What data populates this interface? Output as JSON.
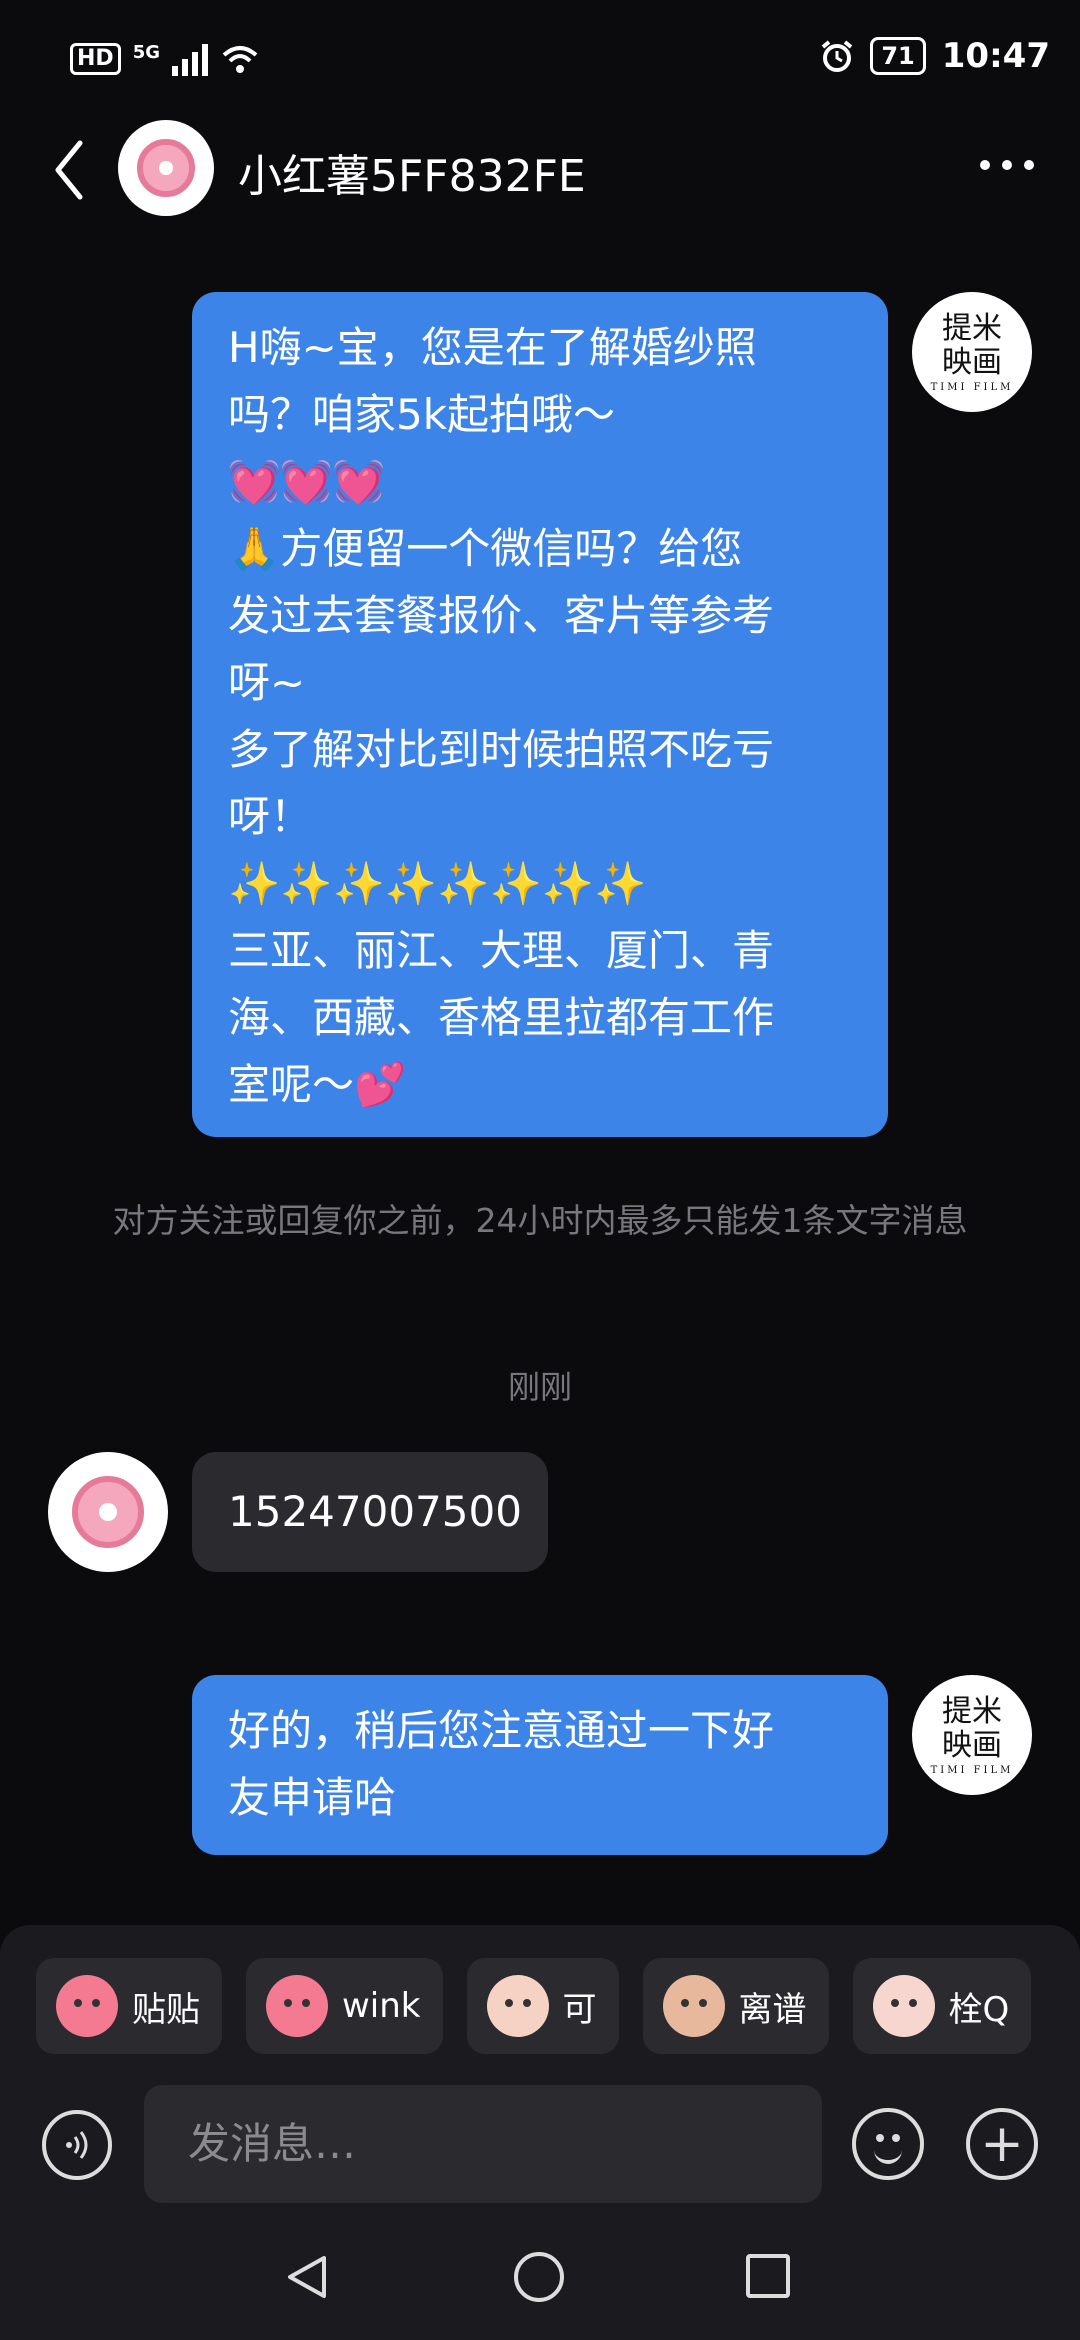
{
  "status_bar": {
    "network": "5G",
    "hd": "HD",
    "battery": "71",
    "time": "10:47"
  },
  "header": {
    "title": "小红薯5FF832FE"
  },
  "sender_logo": {
    "line1": "提米",
    "line2": "映画",
    "tag": "TIMI FILM"
  },
  "messages": {
    "m1": {
      "lines": [
        "H嗨~宝，您是在了解婚纱照",
        "吗？咱家5k起拍哦～",
        "💓💓💓",
        "🙏方便留一个微信吗？给您",
        "发过去套餐报价、客片等参考",
        "呀~",
        "多了解对比到时候拍照不吃亏",
        "呀！",
        "✨✨✨✨✨✨✨✨",
        "三亚、丽江、大理、厦门、青",
        "海、西藏、香格里拉都有工作",
        "室呢～💕"
      ]
    },
    "notice": "对方关注或回复你之前，24小时内最多只能发1条文字消息",
    "time_label": "刚刚",
    "m2": "15247007500",
    "m3": {
      "lines": [
        "好的，稍后您注意通过一下好",
        "友申请哈"
      ]
    }
  },
  "stickers": [
    {
      "label": "贴贴",
      "color": "#f47a92"
    },
    {
      "label": "wink",
      "color": "#f47a92"
    },
    {
      "label": "可",
      "color": "#f6d2c4"
    },
    {
      "label": "离谱",
      "color": "#e8b89c"
    },
    {
      "label": "栓Q",
      "color": "#f7d6d0"
    }
  ],
  "composer": {
    "placeholder": "发消息…"
  },
  "colors": {
    "accent": "#3d84e9",
    "background": "#0b0b0d"
  }
}
